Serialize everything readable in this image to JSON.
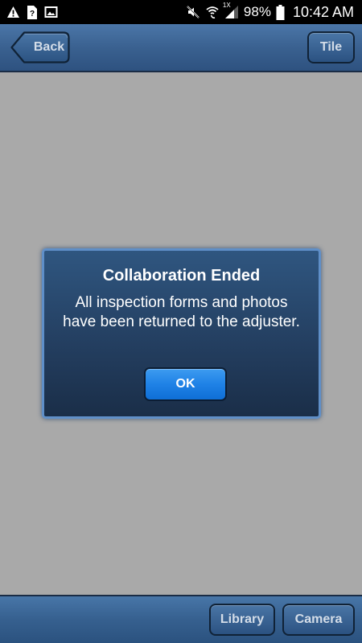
{
  "status_bar": {
    "left_icons": [
      "warning-icon",
      "unknown-file-icon",
      "image-icon"
    ],
    "right_icons": [
      "mute-icon",
      "wifi-calling-icon",
      "signal-icon",
      "battery-icon"
    ],
    "roaming_label": "1X",
    "battery_percent": "98%",
    "battery_level": 0.98,
    "time": "10:42 AM"
  },
  "nav": {
    "back_label": "Back",
    "tile_label": "Tile"
  },
  "dialog": {
    "title": "Collaboration Ended",
    "message": "All inspection forms and photos have been returned to the adjuster.",
    "ok_label": "OK"
  },
  "toolbar": {
    "library_label": "Library",
    "camera_label": "Camera"
  },
  "colors": {
    "bar_blue": "#3a6190",
    "dialog_border": "#5f8fc8",
    "ok_blue": "#1f82e6",
    "background_gray": "#a9a9a9"
  }
}
